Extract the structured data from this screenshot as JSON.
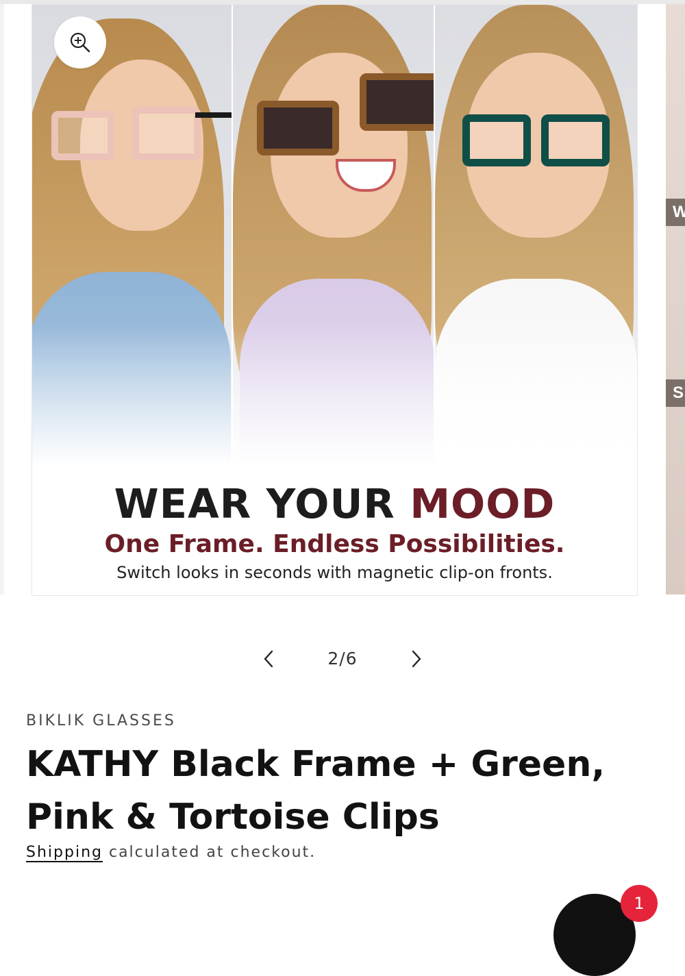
{
  "gallery": {
    "banner": {
      "headline_part1": "WEAR YOUR",
      "headline_part2": "MOOD",
      "subhead": "One Frame. Endless Possibilities.",
      "body": "Switch looks in seconds with magnetic clip-on fronts."
    },
    "peek_tags": [
      "W",
      "S"
    ],
    "zoom_icon": "zoom-in-icon"
  },
  "pager": {
    "current": 2,
    "total": 6,
    "label": "2/6",
    "prev_icon": "chevron-left-icon",
    "next_icon": "chevron-right-icon"
  },
  "product": {
    "vendor": "BIKLIK GLASSES",
    "title": "KATHY Black Frame + Green, Pink & Tortoise Clips",
    "shipping_link": "Shipping",
    "shipping_rest": " calculated at checkout."
  },
  "chat": {
    "badge_count": "1"
  },
  "colors": {
    "accent": "#6b1e27",
    "badge": "#e5243b",
    "text": "#121212"
  }
}
